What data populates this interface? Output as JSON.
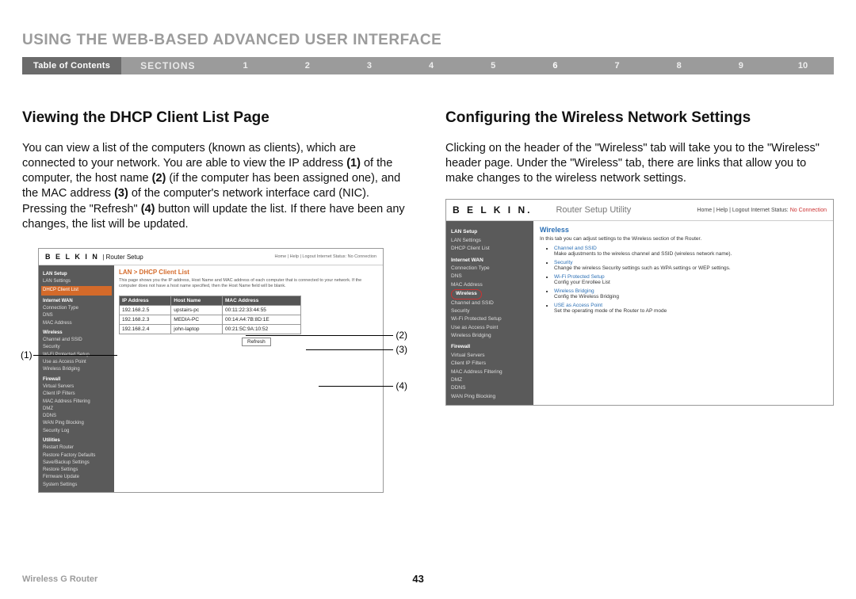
{
  "chapter_title": "USING THE WEB-BASED ADVANCED USER INTERFACE",
  "nav": {
    "toc": "Table of Contents",
    "sections_label": "SECTIONS",
    "items": [
      "1",
      "2",
      "3",
      "4",
      "5",
      "6",
      "7",
      "8",
      "9",
      "10"
    ],
    "active": "6"
  },
  "left": {
    "heading": "Viewing the DHCP Client List Page",
    "para_html": "You can view a list of the computers (known as clients), which are connected to your network. You are able to view the IP address <b>(1)</b> of the computer, the host name <b>(2)</b> (if the computer has been assigned one), and the MAC address <b>(3)</b> of the computer's network interface card (NIC). Pressing the \"Refresh\" <b>(4)</b> button will update the list. If there have been any changes, the list will be updated.",
    "shot": {
      "brand": "B E L K I N",
      "router_label": "Router Setup",
      "status_line": "Home | Help | Logout   Internet Status: No Connection",
      "sidebar": {
        "groups": [
          {
            "title": "LAN Setup",
            "items": [
              "LAN Settings",
              "DHCP Client List"
            ],
            "selected": "DHCP Client List"
          },
          {
            "title": "Internet WAN",
            "items": [
              "Connection Type",
              "DNS",
              "MAC Address"
            ]
          },
          {
            "title": "Wireless",
            "items": [
              "Channel and SSID",
              "Security",
              "Wi-Fi Protected Setup",
              "Use as Access Point",
              "Wireless Bridging"
            ]
          },
          {
            "title": "Firewall",
            "items": [
              "Virtual Servers",
              "Client IP Filters",
              "MAC Address Filtering",
              "DMZ",
              "DDNS",
              "WAN Ping Blocking",
              "Security Log"
            ]
          },
          {
            "title": "Utilities",
            "items": [
              "Restart Router",
              "Restore Factory Defaults",
              "Save/Backup Settings",
              "Restore Settings",
              "Firmware Update",
              "System Settings"
            ]
          }
        ]
      },
      "panel_title": "LAN > DHCP Client List",
      "panel_desc": "This page shows you the IP address, Host Name and MAC address of each computer that is connected to your network. If the computer does not have a host name specified, then the Host Name field will be blank.",
      "table": {
        "headers": [
          "IP Address",
          "Host Name",
          "MAC Address"
        ],
        "rows": [
          [
            "192.168.2.5",
            "upstairs-pc",
            "00:11:22:33:44:55"
          ],
          [
            "192.168.2.3",
            "MEDIA-PC",
            "00:14:A4:7B:8D:1E"
          ],
          [
            "192.168.2.4",
            "john-laptop",
            "00:21:5C:9A:10:52"
          ]
        ]
      },
      "refresh_label": "Refresh",
      "callouts": {
        "c1": "(1)",
        "c2": "(2)",
        "c3": "(3)",
        "c4": "(4)"
      }
    }
  },
  "right": {
    "heading": "Configuring the Wireless Network Settings",
    "para": "Clicking on the header of the \"Wireless\" tab will take you to the \"Wireless\" header page. Under the \"Wireless\" tab, there are links that allow you to make changes to the wireless network settings.",
    "shot": {
      "brand": "B E L K I N.",
      "util": "Router Setup Utility",
      "top_links": "Home | Help | Logout   Internet Status:",
      "top_status": "No Connection",
      "sidebar": {
        "groups": [
          {
            "title": "LAN Setup",
            "items": [
              "LAN Settings",
              "DHCP Client List"
            ]
          },
          {
            "title": "Internet WAN",
            "items": [
              "Connection Type",
              "DNS",
              "MAC Address"
            ]
          },
          {
            "title": "Wireless",
            "selected": true,
            "items": [
              "Channel and SSID",
              "Security",
              "Wi-Fi Protected Setup",
              "Use as Access Point",
              "Wireless Bridging"
            ]
          },
          {
            "title": "Firewall",
            "items": [
              "Virtual Servers",
              "Client IP Filters",
              "MAC Address Filtering",
              "DMZ",
              "DDNS",
              "WAN Ping Blocking"
            ]
          }
        ]
      },
      "panel_heading": "Wireless",
      "panel_intro": "In this tab you can adjust settings to the Wireless section of the Router.",
      "bullets": [
        {
          "link": "Channel and SSID",
          "desc": "Make adjustments to the wireless channel and SSID (wireless network name)."
        },
        {
          "link": "Security",
          "desc": "Change the wireless Security settings such as WPA settings or WEP settings."
        },
        {
          "link": "Wi-Fi Protected Setup",
          "desc": "Config your Enrollee List"
        },
        {
          "link": "Wireless Bridging",
          "desc": "Config the Wireless Bridging"
        },
        {
          "link": "USE as Access Point",
          "desc": "Set the operating mode of the Router to AP mode"
        }
      ]
    }
  },
  "footer": {
    "product": "Wireless G Router",
    "page": "43"
  }
}
